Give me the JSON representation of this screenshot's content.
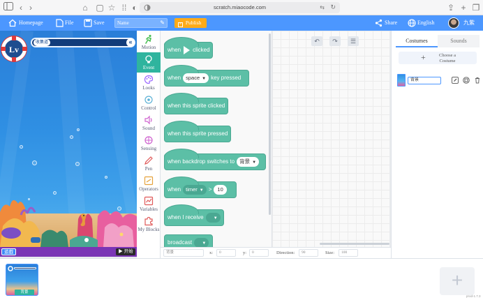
{
  "browser": {
    "url": "scratch.miaocode.com"
  },
  "appbar": {
    "homepage": "Homepage",
    "file": "File",
    "save": "Save",
    "name_placeholder": "Name",
    "publish": "Publish",
    "share": "Share",
    "language": "English",
    "user": "九紫"
  },
  "stage": {
    "level_badge": "Lv",
    "collect_label": "收集道",
    "bottom_left": "遊戲",
    "start_button": "开始"
  },
  "categories": [
    {
      "label": "Motion",
      "color": "#4c97ff"
    },
    {
      "label": "Event",
      "color": "#2fb49e"
    },
    {
      "label": "Looks",
      "color": "#9966ff"
    },
    {
      "label": "Control",
      "color": "#ffab19"
    },
    {
      "label": "Sound",
      "color": "#cf63cf"
    },
    {
      "label": "Sensing",
      "color": "#5cb1d6"
    },
    {
      "label": "Pen",
      "color": "#ff6680"
    },
    {
      "label": "Operators",
      "color": "#59c059"
    },
    {
      "label": "Variables",
      "color": "#ff8c1a"
    },
    {
      "label": "My Blocks",
      "color": "#ff6680"
    }
  ],
  "blocks": {
    "when_flag": {
      "pre": "when",
      "post": "clicked"
    },
    "key_pressed": {
      "pre": "when",
      "key": "space",
      "post": "key pressed"
    },
    "sprite_clicked": "when this sprite clicked",
    "sprite_pressed": "when this sprite pressed",
    "backdrop": {
      "pre": "when backdrop switches to",
      "value": "背景"
    },
    "timer": {
      "pre": "when",
      "sensor": "timer",
      "op": ">",
      "value": "10"
    },
    "receive": {
      "pre": "when I receive"
    },
    "broadcast": {
      "pre": "broadcast"
    }
  },
  "props": {
    "sprite_name": "背景",
    "x_label": "x:",
    "x_value": "0",
    "y_label": "y:",
    "y_value": "0",
    "direction_label": "Direction:",
    "direction_value": "90",
    "size_label": "Size:",
    "size_value": "100"
  },
  "right_panel": {
    "tab_costumes": "Costumes",
    "tab_sounds": "Sounds",
    "choose_costume": "Choose a Costume",
    "costume_name": "背景"
  },
  "tray": {
    "sprite_name": "背景",
    "version": "prod-1.7.3"
  },
  "colors": {
    "accent": "#4c97ff",
    "event": "#5cbfa6",
    "publish": "#ffab19"
  }
}
